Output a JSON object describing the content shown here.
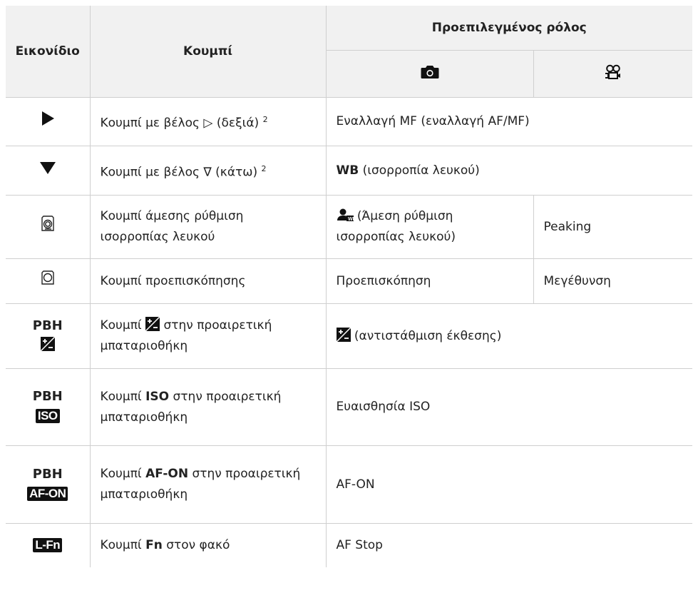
{
  "header": {
    "icon_col": "Εικονίδιο",
    "button_col": "Κουμπί",
    "default_role": "Προεπιλεγμένος ρόλος",
    "photo_icon": "camera-icon",
    "video_icon": "movie-camera-icon"
  },
  "rows": [
    {
      "icon": "right-triangle-icon",
      "button_pre": "Κουμπί με βέλος",
      "arrow": "▷",
      "button_post": "(δεξιά)",
      "sup": "2",
      "role_bold": "",
      "role": "Εναλλαγή MF (εναλλαγή AF/MF)"
    },
    {
      "icon": "down-triangle-icon",
      "button_pre": "Κουμπί με βέλος",
      "arrow": "∇",
      "button_post": "(κάτω)",
      "sup": "2",
      "role_bold": "WB",
      "role": "(ισορροπία λευκού)"
    },
    {
      "icon": "one-touch-wb-button-icon",
      "button": "Κουμπί άμεσης ρύθμιση ισορροπίας λευκού",
      "role_icon": "one-touch-wb-icon",
      "role_photo": "(Άμεση ρύθμιση ισορροπίας λευκού)",
      "role_video": "Peaking"
    },
    {
      "icon": "preview-button-icon",
      "button": "Κουμπί προεπισκόπησης",
      "role_photo": "Προεπισκόπηση",
      "role_video": "Μεγέθυνση"
    },
    {
      "icon_text": "PBH",
      "icon": "exposure-comp-icon",
      "button_pre": "Κουμπί",
      "button_post": "στην προαιρετική μπαταριοθήκη",
      "role": "(αντιστάθμιση έκθεσης)"
    },
    {
      "icon_text": "PBH",
      "badge": "ISO",
      "button_pre": "Κουμπί",
      "button_bold": "ISO",
      "button_post": "στην προαιρετική μπαταριοθήκη",
      "role": "Ευαισθησία ISO"
    },
    {
      "icon_text": "PBH",
      "badge": "AF-ON",
      "button_pre": "Κουμπί",
      "button_bold": "AF-ON",
      "button_post": "στην προαιρετική μπαταριοθήκη",
      "role": "AF-ON"
    },
    {
      "badge": "L-Fn",
      "button_pre": "Κουμπί",
      "button_bold": "Fn",
      "button_post": "στον φακό",
      "role": "AF Stop"
    }
  ]
}
